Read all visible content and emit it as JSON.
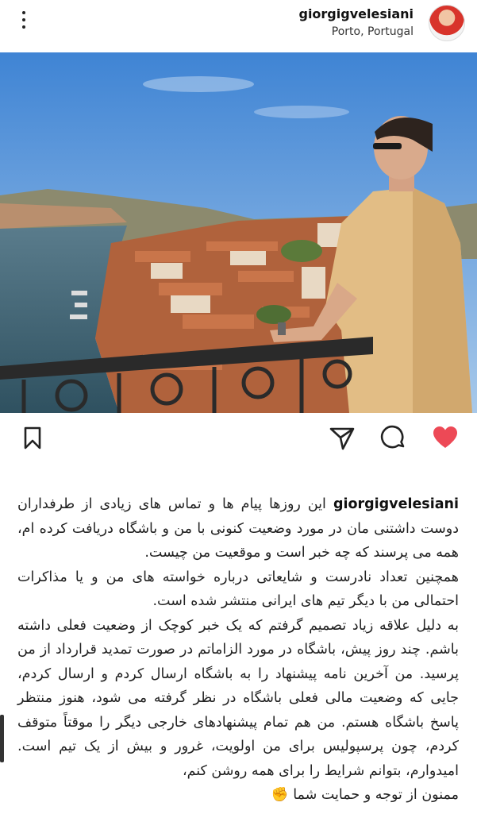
{
  "post": {
    "username": "giorgigvelesiani",
    "location": "Porto, Portugal"
  },
  "icons": {
    "menu": "more-vertical-icon",
    "bookmark": "bookmark-icon",
    "share": "paper-plane-icon",
    "comment": "comment-bubble-icon",
    "like": "heart-icon",
    "like_color": "#ed4956",
    "reaction_emoji": "✊"
  },
  "caption": {
    "username": "giorgigvelesiani",
    "intro": "این روزها پیام ها و تماس های زیادی از طرفداران دوست داشتنی مان در مورد وضعیت کنونی با من و باشگاه دریافت کرده ام، همه می پرسند که چه خبر است و موقعیت من چیست.",
    "para2": "همچنین تعداد نادرست و شایعاتی درباره خواسته های من و یا مذاکرات احتمالی من با دیگر تیم های ایرانی منتشر شده است.",
    "para3": "به دلیل علاقه زیاد تصمیم گرفتم که یک خبر کوچک از وضعیت فعلی داشته باشم. چند روز پیش، باشگاه در مورد الزاماتم در صورت تمدید قرارداد از من پرسید. من آخرین نامه پیشنهاد را به باشگاه ارسال کردم و ارسال کردم، جایی که وضعیت مالی فعلی باشگاه در نظر گرفته می شود، هنوز منتظر پاسخ باشگاه هستم. من هم تمام پیشنهادهای خارجی دیگر را موقتاً متوقف کردم، چون پرسپولیس برای من اولویت، غرور و بیش از یک تیم است. امیدوارم، بتوانم شرایط را برای همه روشن کنم،",
    "closing": "ممنون از توجه و حمایت شما"
  }
}
